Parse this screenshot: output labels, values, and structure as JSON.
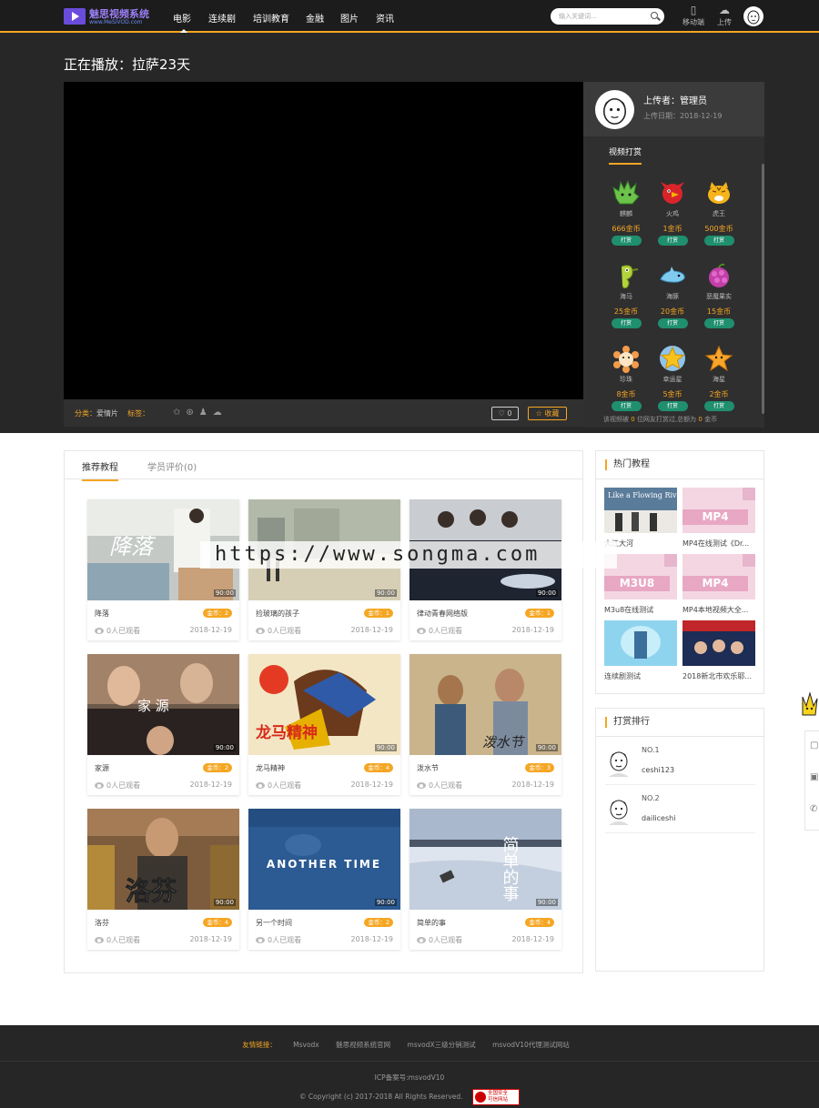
{
  "brand": {
    "name": "魅思视频系统",
    "sub": "www.MeSiVOD.com",
    "accent": "#f5a623",
    "logo_color": "#6a4cdc"
  },
  "nav": {
    "items": [
      {
        "label": "电影",
        "active": true
      },
      {
        "label": "连续剧"
      },
      {
        "label": "培训教育"
      },
      {
        "label": "金融"
      },
      {
        "label": "图片"
      },
      {
        "label": "资讯"
      }
    ],
    "search_placeholder": "输入关键词...",
    "mobile_label": "移动端",
    "upload_label": "上传"
  },
  "player": {
    "now_playing": "正在播放：拉萨23天",
    "category_label": "分类：",
    "category_value": "爱情片",
    "tags_label": "标签：",
    "like_count": "0",
    "fav_label": "收藏"
  },
  "uploader": {
    "name": "上传者：管理员",
    "date": "上传日期：2018-12-19"
  },
  "tips": {
    "title": "视频打赏",
    "gifts": [
      {
        "name": "麒麟",
        "coin": "666金币",
        "btn": "打赏",
        "icon": "qilin-icon"
      },
      {
        "name": "火鸡",
        "coin": "1金币",
        "btn": "打赏",
        "icon": "turkey-icon"
      },
      {
        "name": "虎王",
        "coin": "500金币",
        "btn": "打赏",
        "icon": "tiger-icon"
      },
      {
        "name": "海马",
        "coin": "25金币",
        "btn": "打赏",
        "icon": "seahorse-icon"
      },
      {
        "name": "海豚",
        "coin": "20金币",
        "btn": "打赏",
        "icon": "dolphin-icon"
      },
      {
        "name": "恶魔果实",
        "coin": "15金币",
        "btn": "打赏",
        "icon": "devil-fruit-icon"
      },
      {
        "name": "珍珠",
        "coin": "8金币",
        "btn": "打赏",
        "icon": "pearl-icon"
      },
      {
        "name": "幸运星",
        "coin": "5金币",
        "btn": "打赏",
        "icon": "lucky-star-icon"
      },
      {
        "name": "海星",
        "coin": "2金币",
        "btn": "打赏",
        "icon": "starfish-icon"
      }
    ],
    "summary_pre": "该视频被",
    "summary_people": "0",
    "summary_mid": "位网友打赏过,总额为",
    "summary_total": "0",
    "summary_post": "金币"
  },
  "tabs": [
    {
      "label": "推荐教程",
      "active": true
    },
    {
      "label": "学员评价(0)"
    }
  ],
  "videos": [
    {
      "title": "降落",
      "coin": "金币：2",
      "duration": "90:00",
      "views": "0人已观看",
      "date": "2018-12-19"
    },
    {
      "title": "捡玻璃的孩子",
      "coin": "金币：1",
      "duration": "90:00",
      "views": "0人已观看",
      "date": "2018-12-19"
    },
    {
      "title": "律动青春网络版",
      "coin": "金币：1",
      "duration": "90:00",
      "views": "0人已观看",
      "date": "2018-12-19"
    },
    {
      "title": "家源",
      "coin": "金币：2",
      "duration": "90:00",
      "views": "0人已观看",
      "date": "2018-12-19"
    },
    {
      "title": "龙马精神",
      "coin": "金币：4",
      "duration": "90:00",
      "views": "0人已观看",
      "date": "2018-12-19"
    },
    {
      "title": "泼水节",
      "coin": "金币：3",
      "duration": "90:00",
      "views": "0人已观看",
      "date": "2018-12-19"
    },
    {
      "title": "洛芬",
      "coin": "金币：4",
      "duration": "90:00",
      "views": "0人已观看",
      "date": "2018-12-19"
    },
    {
      "title": "另一个时间",
      "coin": "金币：2",
      "duration": "90:00",
      "views": "0人已观看",
      "date": "2018-12-19"
    },
    {
      "title": "简单的事",
      "coin": "金币：4",
      "duration": "90:00",
      "views": "0人已观看",
      "date": "2018-12-19"
    }
  ],
  "thumb_text": {
    "t1": "降落",
    "t4": "家 源",
    "t5": "龙马精神",
    "t6": "泼水节",
    "t7": "洛芬",
    "t8": "ANOTHER TIME",
    "t9": "简单的事"
  },
  "hot": {
    "title": "热门教程",
    "items": [
      {
        "title": "大江大河",
        "thumb_text": "Like a Flowing River"
      },
      {
        "title": "MP4在线测试《Dr...",
        "label": "MP4"
      },
      {
        "title": "M3u8在线测试",
        "label": "M3U8"
      },
      {
        "title": "MP4本地视频大全...",
        "label": "MP4"
      },
      {
        "title": "连续剧测试"
      },
      {
        "title": "2018新北市欢乐耶..."
      }
    ]
  },
  "rank": {
    "title": "打赏排行",
    "items": [
      {
        "no": "NO.1",
        "name": "ceshi123"
      },
      {
        "no": "NO.2",
        "name": "dailiceshi"
      }
    ]
  },
  "footer": {
    "links_label": "友情链接：",
    "links": [
      "Msvodx",
      "魅思视频系统官网",
      "msvodX三级分销测试",
      "msvodV10代理测试网站"
    ],
    "icp": "ICP备案号:msvodV10",
    "copyright": "© Copyright (c) 2017-2018 All Rights Reserved.",
    "badge_l1": "全国安全",
    "badge_l2": "可信网站"
  },
  "watermark": "https://www.songma.com"
}
